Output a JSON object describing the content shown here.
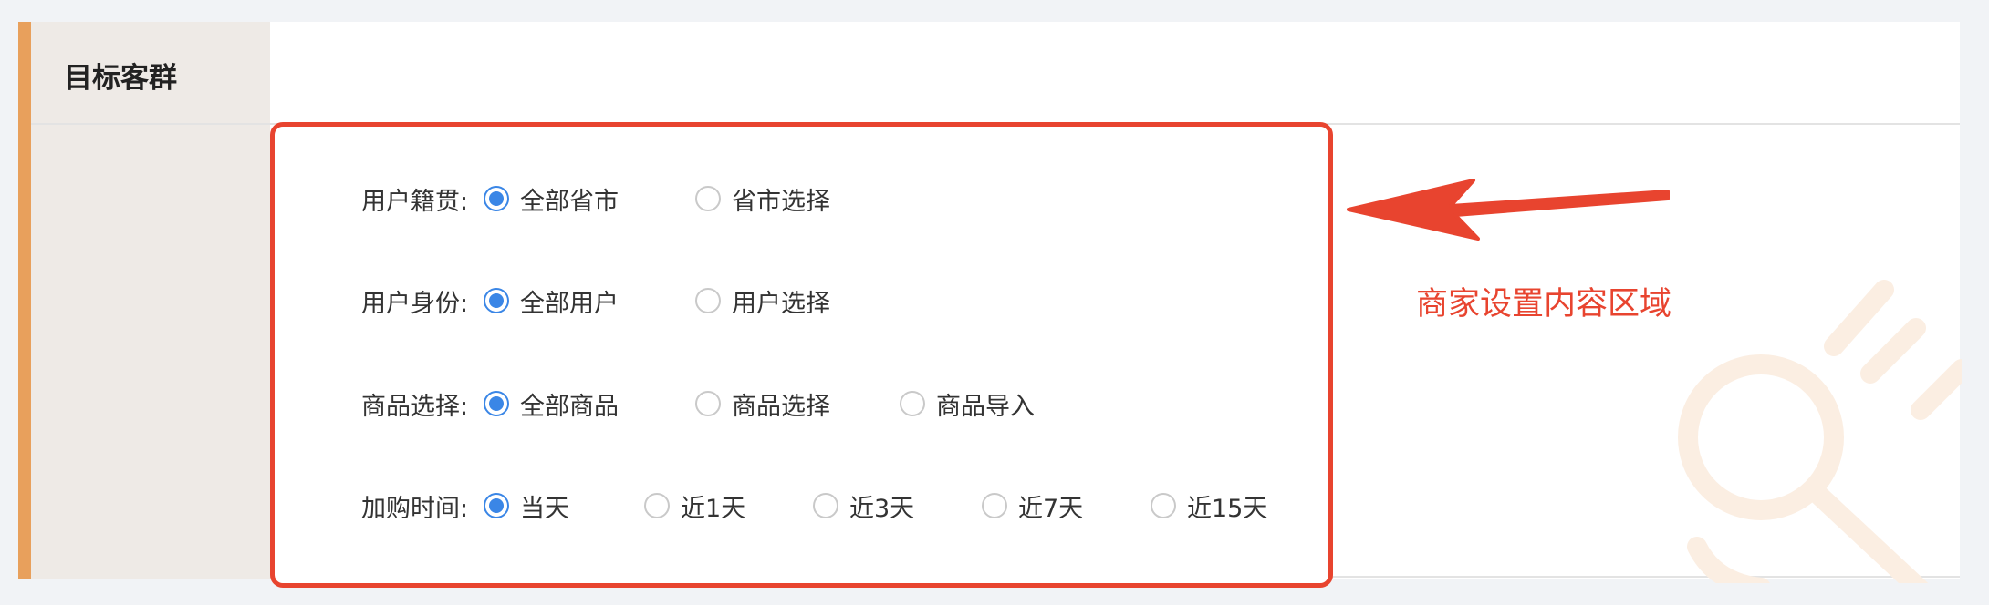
{
  "section": {
    "title": "目标客群"
  },
  "form": {
    "rows": [
      {
        "label": "用户籍贯:",
        "options": [
          {
            "label": "全部省市",
            "checked": true
          },
          {
            "label": "省市选择",
            "checked": false
          }
        ]
      },
      {
        "label": "用户身份:",
        "options": [
          {
            "label": "全部用户",
            "checked": true
          },
          {
            "label": "用户选择",
            "checked": false
          }
        ]
      },
      {
        "label": "商品选择:",
        "options": [
          {
            "label": "全部商品",
            "checked": true
          },
          {
            "label": "商品选择",
            "checked": false
          },
          {
            "label": "商品导入",
            "checked": false
          }
        ]
      },
      {
        "label": "加购时间:",
        "options": [
          {
            "label": "当天",
            "checked": true
          },
          {
            "label": "近1天",
            "checked": false
          },
          {
            "label": "近3天",
            "checked": false
          },
          {
            "label": "近7天",
            "checked": false
          },
          {
            "label": "近15天",
            "checked": false
          }
        ]
      }
    ]
  },
  "annotation": {
    "text": "商家设置内容区域",
    "color": "#e8442f"
  },
  "colors": {
    "accent_bar": "#e8a05c",
    "radio_checked": "#3a86e6",
    "highlight_border": "#e8442f"
  }
}
